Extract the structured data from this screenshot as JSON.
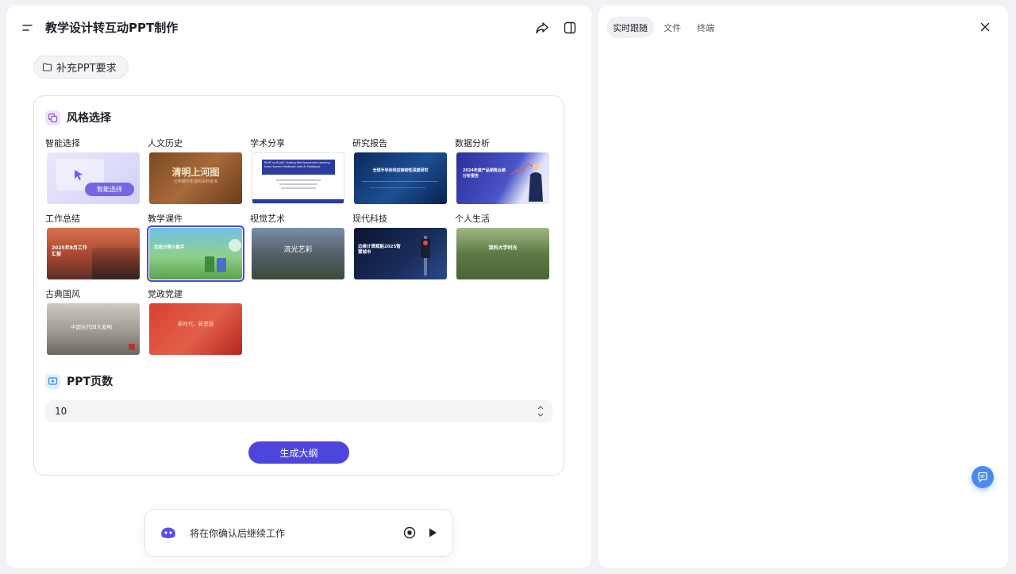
{
  "header": {
    "title": "教学设计转互动PPT制作"
  },
  "supplement": {
    "label": "补充PPT要求"
  },
  "style_section": {
    "title": "风格选择"
  },
  "styles": [
    {
      "label": "智能选择",
      "thumb_text": "智能选择"
    },
    {
      "label": "人文历史",
      "thumb_text": "清明上河图",
      "thumb_sub": "北宋都市生活的百科全书"
    },
    {
      "label": "学术分享",
      "thumb_text": "RLHF vs RLAIF: Scaling Reinforcement Learning from Human Feedback with AI Feedback"
    },
    {
      "label": "研究报告",
      "thumb_text": "全球半导体供应链韧性深度研究"
    },
    {
      "label": "数据分析",
      "thumb_text": "2024年度产品销售业绩分析报告"
    },
    {
      "label": "工作总结",
      "thumb_text": "2025年8月工作汇报"
    },
    {
      "label": "教学课件",
      "thumb_text": "垃圾分类小能手"
    },
    {
      "label": "视觉艺术",
      "thumb_text": "流光艺彩"
    },
    {
      "label": "现代科技",
      "thumb_text": "边缘计算赋能2025智慧城市"
    },
    {
      "label": "个人生活",
      "thumb_text": "我的大学时光"
    },
    {
      "label": "古典国风",
      "thumb_text": "中国古代四大发明"
    },
    {
      "label": "党政党建",
      "thumb_text": "新时代，新思想"
    }
  ],
  "pages_section": {
    "title": "PPT页数",
    "value": "10"
  },
  "generate_button": {
    "label": "生成大纲"
  },
  "status": {
    "message": "将在你确认后继续工作"
  },
  "right_tabs": [
    {
      "label": "实时跟随",
      "active": true
    },
    {
      "label": "文件",
      "active": false
    },
    {
      "label": "终端",
      "active": false
    }
  ],
  "colors": {
    "accent": "#4e46dc",
    "float_button": "#4b8af0",
    "background": "#f1f2f5"
  }
}
